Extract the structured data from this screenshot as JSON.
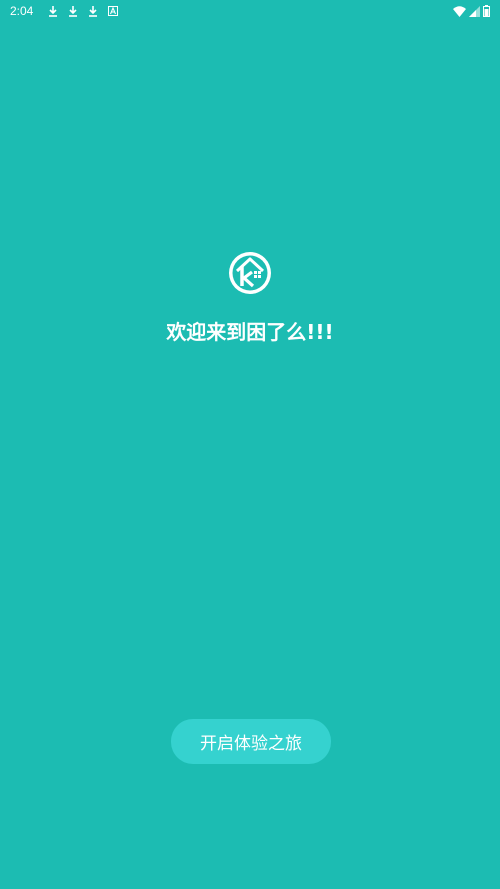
{
  "status_bar": {
    "time": "2:04",
    "left_icons": [
      "download-icon",
      "download-icon",
      "download-icon",
      "a-box-icon"
    ],
    "right_icons": [
      "wifi-icon",
      "signal-icon",
      "battery-icon"
    ]
  },
  "splash": {
    "logo_icon": "house-k-logo-icon",
    "welcome_text": "欢迎来到困了么!!!",
    "start_button_label": "开启体验之旅"
  },
  "colors": {
    "background": "#1cbcb2",
    "button": "#35d2cf",
    "text": "#ffffff"
  }
}
